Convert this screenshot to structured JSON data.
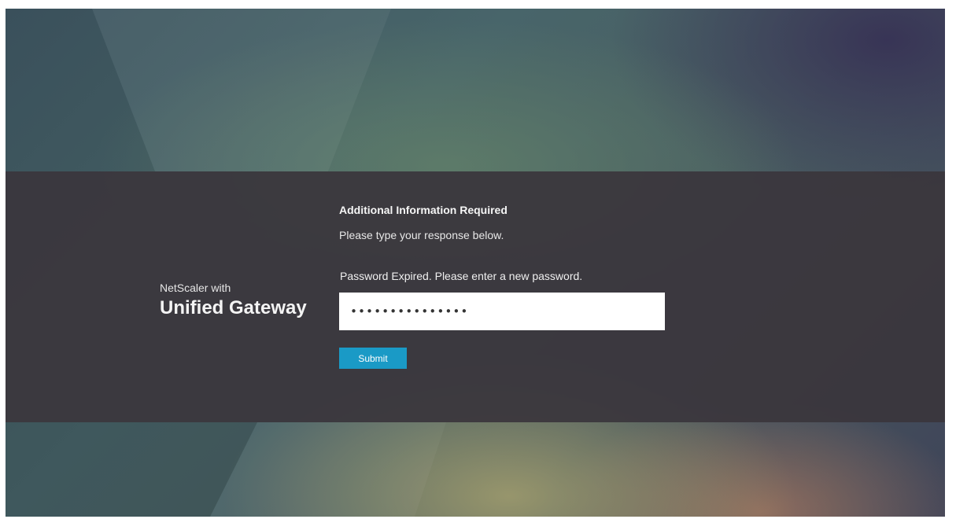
{
  "brand": {
    "product_prefix": "NetScaler with",
    "product_name": "Unified Gateway"
  },
  "form": {
    "heading": "Additional Information Required",
    "instructions": "Please type your response below.",
    "field_label": "Password Expired. Please enter a new password.",
    "password_value": "passwordpasswor",
    "submit_label": "Submit"
  },
  "colors": {
    "panel": "#3a363c",
    "submit_button": "#1a9ac6",
    "input_background": "#ffffff"
  }
}
